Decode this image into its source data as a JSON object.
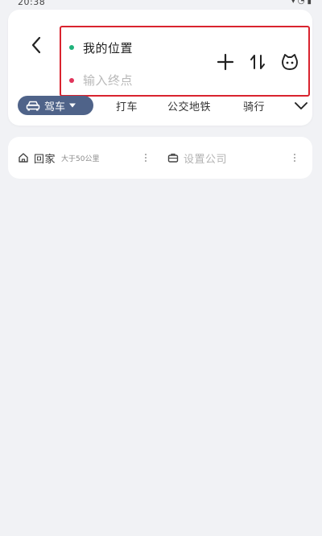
{
  "status_bar": {
    "time": "20:38",
    "icons": [
      "signal-icon",
      "wifi-icon",
      "battery-icon"
    ]
  },
  "route": {
    "origin": {
      "label": "我的位置",
      "dot_color": "#1fb27a"
    },
    "destination": {
      "value": "",
      "placeholder": "输入终点",
      "dot_color": "#e0345a"
    },
    "highlight_color": "#d9232e",
    "actions": [
      "add-icon",
      "swap-icon",
      "assistant-icon"
    ]
  },
  "modes": {
    "active": {
      "label": "驾车",
      "icon": "car-icon",
      "color": "#4f6389"
    },
    "tabs": [
      "打车",
      "公交地铁",
      "骑行"
    ],
    "expand_icon": "chevron-down-icon"
  },
  "shortcuts": {
    "home": {
      "label": "回家",
      "subtitle": "大于50公里",
      "icon": "home-icon"
    },
    "company": {
      "placeholder": "设置公司",
      "icon": "briefcase-icon"
    }
  },
  "colors": {
    "background": "#f1f2f5",
    "card": "#ffffff"
  }
}
